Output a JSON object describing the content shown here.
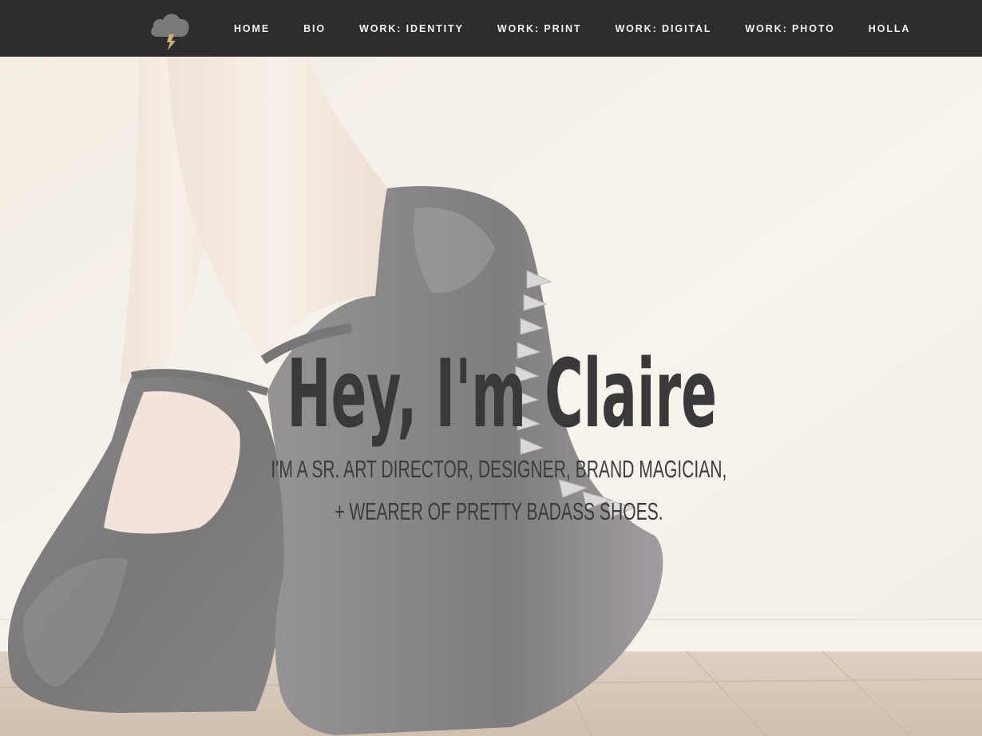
{
  "nav": {
    "logo_icon": "storm-cloud-lightning-icon",
    "items": [
      {
        "label": "HOME"
      },
      {
        "label": "BIO"
      },
      {
        "label": "WORK: IDENTITY"
      },
      {
        "label": "WORK: PRINT"
      },
      {
        "label": "WORK: DIGITAL"
      },
      {
        "label": "WORK: PHOTO"
      },
      {
        "label": "HOLLA"
      }
    ]
  },
  "hero": {
    "title": "Hey, I'm Claire",
    "subtitle_line1": "I'm a Sr. Art Director, Designer, Brand Magician,",
    "subtitle_line2": "+ Wearer of Pretty Badass Shoes.",
    "background_image": "black-spiked-platform-heels-photo"
  },
  "colors": {
    "nav_bg": "#2f2d2b",
    "nav_text": "#f3f3f3",
    "logo_cloud": "#7a7a7a",
    "logo_bolt": "#c9b27a",
    "heading_text": "#3a3838"
  }
}
